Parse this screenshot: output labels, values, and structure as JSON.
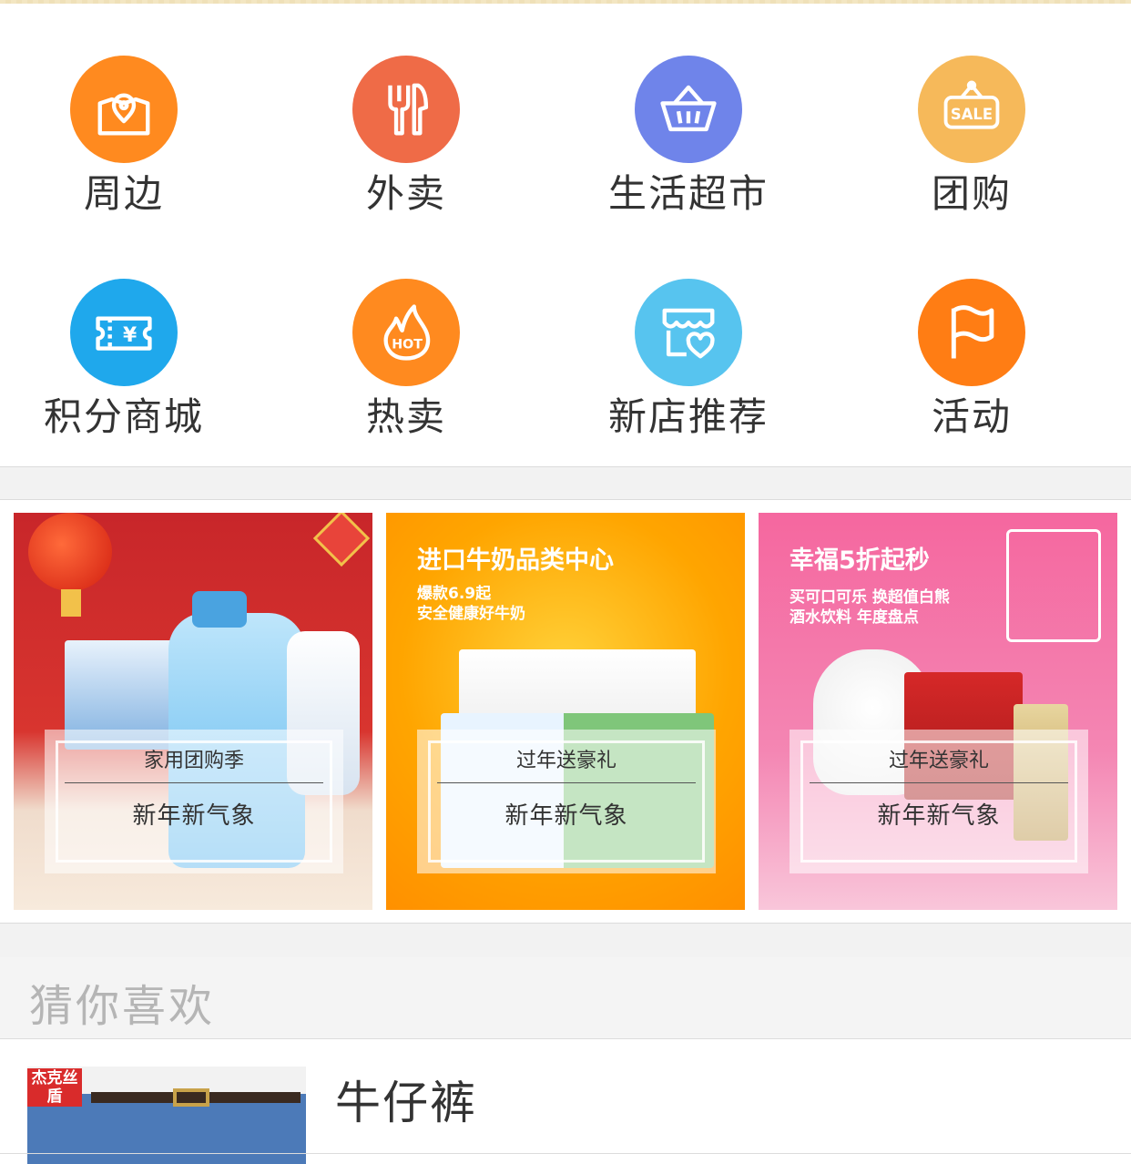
{
  "categories": [
    {
      "label": "周边",
      "icon": "location-bag-icon",
      "color": "#ff8a1f"
    },
    {
      "label": "外卖",
      "icon": "fork-knife-icon",
      "color": "#ef6b47"
    },
    {
      "label": "生活超市",
      "icon": "basket-icon",
      "color": "#6f84ea"
    },
    {
      "label": "团购",
      "icon": "sale-tag-icon",
      "color": "#f6b95a"
    },
    {
      "label": "积分商城",
      "icon": "ticket-icon",
      "color": "#1fa8ec"
    },
    {
      "label": "热卖",
      "icon": "hot-flame-icon",
      "color": "#ff8a1f"
    },
    {
      "label": "新店推荐",
      "icon": "store-heart-icon",
      "color": "#57c4ef"
    },
    {
      "label": "活动",
      "icon": "flag-icon",
      "color": "#ff7d14"
    }
  ],
  "banners": [
    {
      "title": "",
      "sub1": "",
      "sub2": "",
      "overlay_top": "家用团购季",
      "overlay_bottom": "新年新气象"
    },
    {
      "title": "进口牛奶品类中心",
      "sub1": "爆款6.9起",
      "sub2": "安全健康好牛奶",
      "overlay_top": "过年送豪礼",
      "overlay_bottom": "新年新气象"
    },
    {
      "title": "幸福5折起秒",
      "sub1": "买可口可乐 换超值白熊",
      "sub2": "酒水饮料 年度盘点",
      "overlay_top": "过年送豪礼",
      "overlay_bottom": "新年新气象"
    }
  ],
  "recommend": {
    "title": "猜你喜欢"
  },
  "products": [
    {
      "name": "牛仔裤",
      "brand": "杰克丝盾"
    }
  ]
}
